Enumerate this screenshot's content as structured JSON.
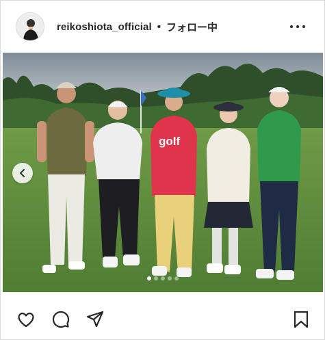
{
  "header": {
    "username": "reikoshiota_official",
    "separator": "•",
    "follow_state": "フォロー中",
    "avatar_icon": "profile-avatar",
    "more_icon": "more-options-icon"
  },
  "post": {
    "carousel": {
      "slide_count": 5,
      "active_index": 0,
      "prev_icon": "chevron-left-icon"
    },
    "scene": {
      "shirt_text": "golf"
    }
  },
  "actions": {
    "like_icon": "heart-icon",
    "comment_icon": "comment-icon",
    "share_icon": "send-icon",
    "save_icon": "bookmark-icon"
  },
  "colors": {
    "text": "#262626",
    "border": "#dbdbdb",
    "grass": "#5f8a3e",
    "sky": "#c9cdd1"
  }
}
